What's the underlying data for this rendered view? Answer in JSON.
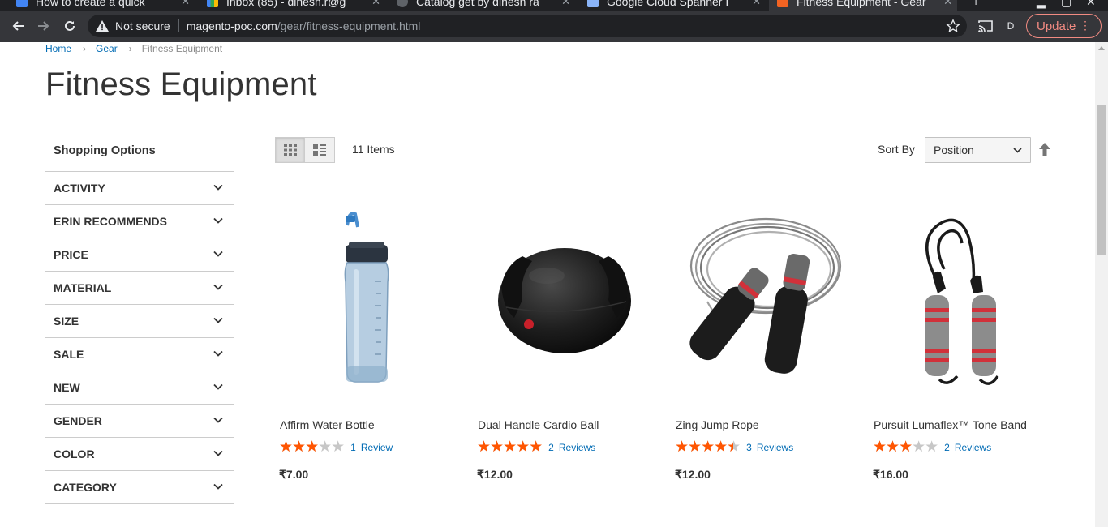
{
  "browser": {
    "tabs": [
      {
        "title": "How to create a quick",
        "active": false
      },
      {
        "title": "Inbox (85) - dinesh.r@g",
        "active": false
      },
      {
        "title": "Catalog get by dinesh ra",
        "active": false
      },
      {
        "title": "Google Cloud Spanner I",
        "active": false
      },
      {
        "title": "Fitness Equipment - Gear",
        "active": true
      }
    ],
    "security_label": "Not secure",
    "url_host": "magento-poc.com",
    "url_path": "/gear/fitness-equipment.html",
    "profile_initial": "D",
    "update_label": "Update"
  },
  "breadcrumbs": [
    {
      "label": "Home",
      "link": true
    },
    {
      "label": "Gear",
      "link": true
    },
    {
      "label": "Fitness Equipment",
      "link": false
    }
  ],
  "page_title": "Fitness Equipment",
  "sidebar": {
    "title": "Shopping Options",
    "filters": [
      "ACTIVITY",
      "ERIN RECOMMENDS",
      "PRICE",
      "MATERIAL",
      "SIZE",
      "SALE",
      "NEW",
      "GENDER",
      "COLOR",
      "CATEGORY"
    ]
  },
  "toolbar": {
    "amount": "11 Items",
    "sort_label": "Sort By",
    "sort_value": "Position"
  },
  "products": [
    {
      "name": "Affirm Water Bottle",
      "rating_fraction": 0.6,
      "review_count": "1",
      "review_word": "Review",
      "price": "₹7.00",
      "image": "water-bottle"
    },
    {
      "name": "Dual Handle Cardio Ball",
      "rating_fraction": 1.0,
      "review_count": "2",
      "review_word": "Reviews",
      "price": "₹12.00",
      "image": "cardio-ball"
    },
    {
      "name": "Zing Jump Rope",
      "rating_fraction": 0.9,
      "review_count": "3",
      "review_word": "Reviews",
      "price": "₹12.00",
      "image": "jump-rope"
    },
    {
      "name": "Pursuit Lumaflex™ Tone Band",
      "rating_fraction": 0.6,
      "review_count": "2",
      "review_word": "Reviews",
      "price": "₹16.00",
      "image": "tone-band"
    }
  ],
  "colors": {
    "link": "#006bb4",
    "star": "#ff5501",
    "update_accent": "#f28b82"
  }
}
